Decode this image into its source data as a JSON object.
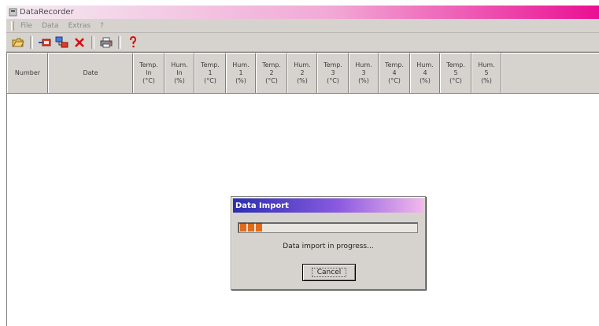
{
  "window": {
    "title": "DataRecorder"
  },
  "menu": [
    "File",
    "Data",
    "Extras",
    "?"
  ],
  "toolbar": {
    "buttons": [
      {
        "name": "open-folder-icon"
      },
      {
        "name": "connect-device-icon"
      },
      {
        "name": "network-icon"
      },
      {
        "name": "delete-icon"
      },
      {
        "name": "print-icon"
      },
      {
        "name": "help-icon"
      }
    ]
  },
  "table": {
    "columns": [
      "Number",
      "Date",
      "Temp.\nIn\n(°C)",
      "Hum.\nIn\n(%)",
      "Temp.\n1\n(°C)",
      "Hum.\n1\n(%)",
      "Temp.\n2\n(°C)",
      "Hum.\n2\n(%)",
      "Temp.\n3\n(°C)",
      "Hum.\n3\n(%)",
      "Temp.\n4\n(°C)",
      "Hum.\n4\n(%)",
      "Temp.\n5\n(°C)",
      "Hum.\n5\n(%)"
    ]
  },
  "dialog": {
    "title": "Data Import",
    "message": "Data import in progress...",
    "cancel_label": "Cancel",
    "progress_blocks": 3
  },
  "colors": {
    "title_gradient_end": "#ea0f92",
    "dialog_title_start": "#2a2fb0",
    "progress_fill": "#e06b1a"
  }
}
